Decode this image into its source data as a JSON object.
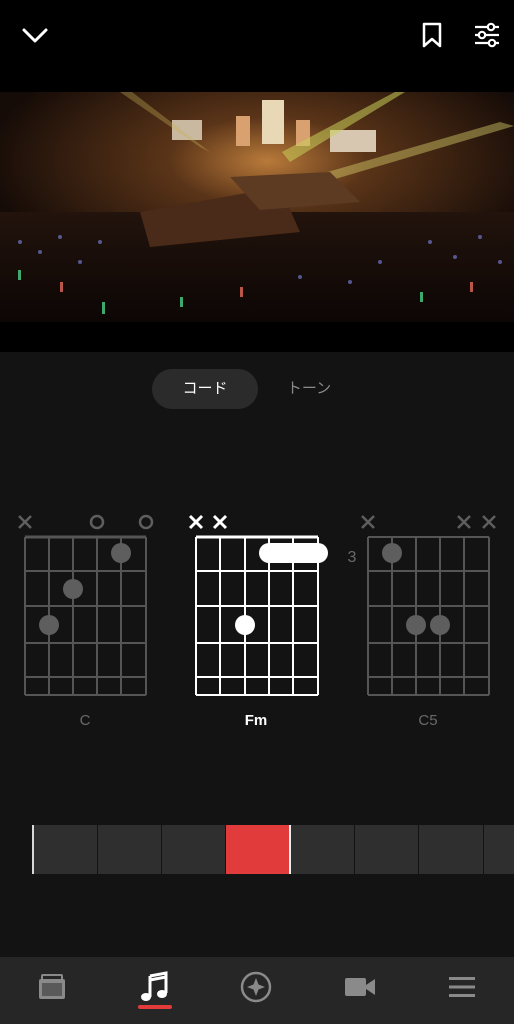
{
  "header": {
    "close_icon": "chevron-down-icon",
    "bookmark_icon": "bookmark-icon",
    "settings_icon": "sliders-icon"
  },
  "video": {
    "icon": "video-thumbnail"
  },
  "tabs": {
    "chord_label": "コード",
    "tone_label": "トーン"
  },
  "chords": [
    {
      "name": "C",
      "state": "previous"
    },
    {
      "name": "Fm",
      "state": "current"
    },
    {
      "name": "C5",
      "state": "next"
    }
  ],
  "fret_marker": "3",
  "timeline": {
    "current_segment": 4,
    "segment_count": 8,
    "highlight_color": "#e23b3b"
  },
  "bottom_nav": {
    "items": [
      {
        "icon": "amp-icon"
      },
      {
        "icon": "music-note-icon",
        "active": true
      },
      {
        "icon": "compass-icon"
      },
      {
        "icon": "video-camera-icon"
      },
      {
        "icon": "menu-icon"
      }
    ],
    "active_color": "#e23b3b"
  }
}
